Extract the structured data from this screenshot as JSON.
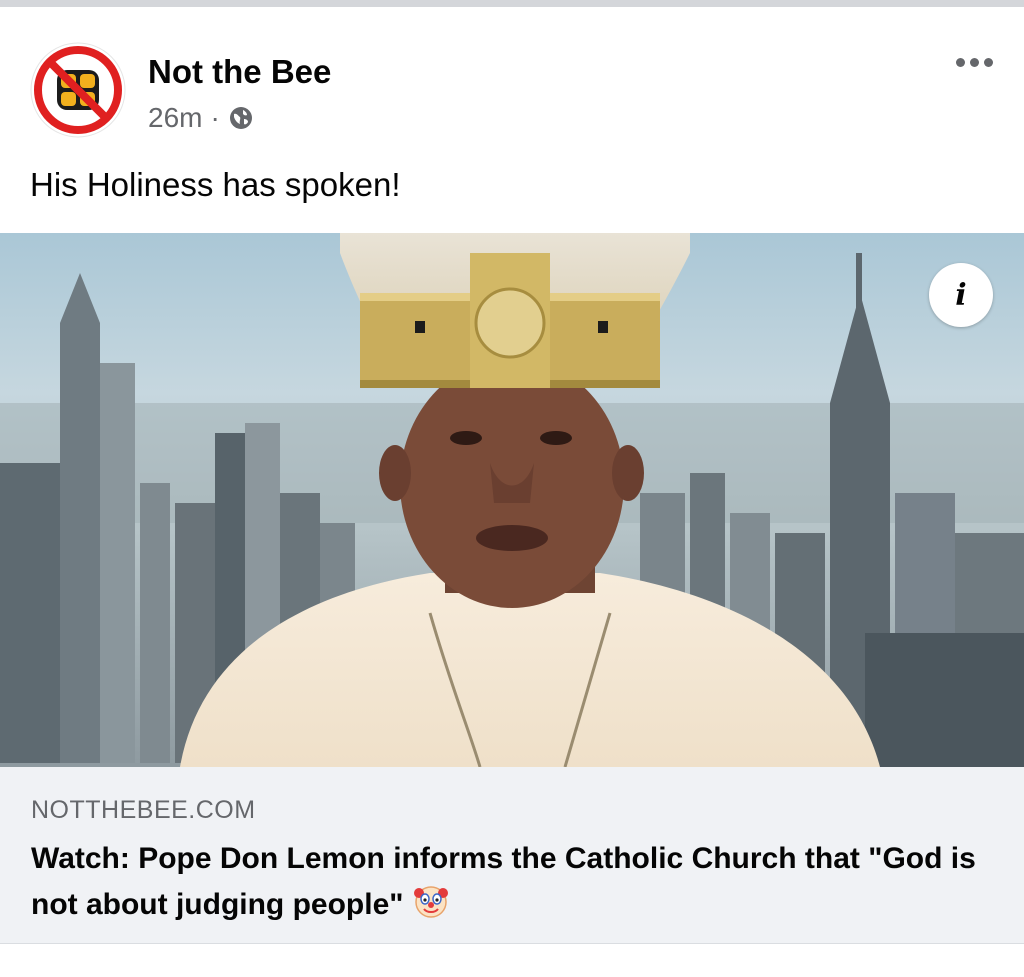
{
  "post": {
    "page_name": "Not the Bee",
    "timestamp": "26m",
    "separator": "·",
    "audience_icon": "globe-icon",
    "caption": "His Holiness has spoken!",
    "more_icon": "more-horizontal-icon",
    "info_icon_label": "i"
  },
  "link_preview": {
    "domain": "NOTTHEBEE.COM",
    "title": "Watch: Pope Don Lemon informs the Catholic Church that \"God is not about judging people\"",
    "title_emoji": "clown-face-icon"
  },
  "colors": {
    "secondary_text": "#65676b",
    "primary_text": "#050505",
    "link_panel_bg": "#f0f2f5",
    "logo_red": "#e02020",
    "logo_gold": "#f2b01e"
  }
}
